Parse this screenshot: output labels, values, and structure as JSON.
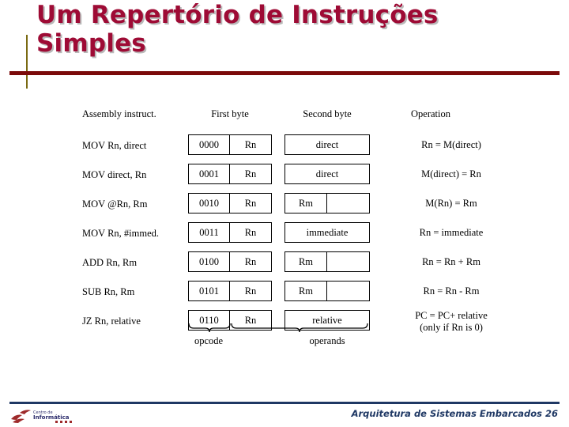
{
  "slide": {
    "title": "Um Repertório de Instruções\nSimples",
    "title_color": "#9E0B35",
    "rule_color": "#7B0A0A"
  },
  "table": {
    "headers": {
      "assembly": "Assembly instruct.",
      "first_byte": "First byte",
      "second_byte": "Second byte",
      "operation": "Operation"
    },
    "rows": [
      {
        "assembly": "MOV Rn, direct",
        "opcode": "0000",
        "reg": "Rn",
        "second_layout": "full",
        "second_a": "direct",
        "second_b": "",
        "operation": "Rn = M(direct)"
      },
      {
        "assembly": "MOV direct, Rn",
        "opcode": "0001",
        "reg": "Rn",
        "second_layout": "full",
        "second_a": "direct",
        "second_b": "",
        "operation": "M(direct) = Rn"
      },
      {
        "assembly": "MOV @Rn, Rm",
        "opcode": "0010",
        "reg": "Rn",
        "second_layout": "split",
        "second_a": "Rm",
        "second_b": "",
        "operation": "M(Rn) = Rm"
      },
      {
        "assembly": "MOV Rn, #immed.",
        "opcode": "0011",
        "reg": "Rn",
        "second_layout": "full",
        "second_a": "immediate",
        "second_b": "",
        "operation": "Rn = immediate"
      },
      {
        "assembly": "ADD Rn, Rm",
        "opcode": "0100",
        "reg": "Rn",
        "second_layout": "split",
        "second_a": "Rm",
        "second_b": "",
        "operation": "Rn = Rn + Rm"
      },
      {
        "assembly": "SUB Rn, Rm",
        "opcode": "0101",
        "reg": "Rn",
        "second_layout": "split",
        "second_a": "Rm",
        "second_b": "",
        "operation": "Rn = Rn - Rm"
      },
      {
        "assembly": "JZ  Rn, relative",
        "opcode": "0110",
        "reg": "Rn",
        "second_layout": "full",
        "second_a": "relative",
        "second_b": "",
        "operation": "PC = PC+ relative\n(only if Rn is 0)"
      }
    ]
  },
  "braces": {
    "opcode_label": "opcode",
    "operands_label": "operands"
  },
  "footer": {
    "text": "Arquitetura de Sistemas Embarcados 26",
    "color": "#1F3864",
    "logo": "ci-ufpe-logo"
  }
}
